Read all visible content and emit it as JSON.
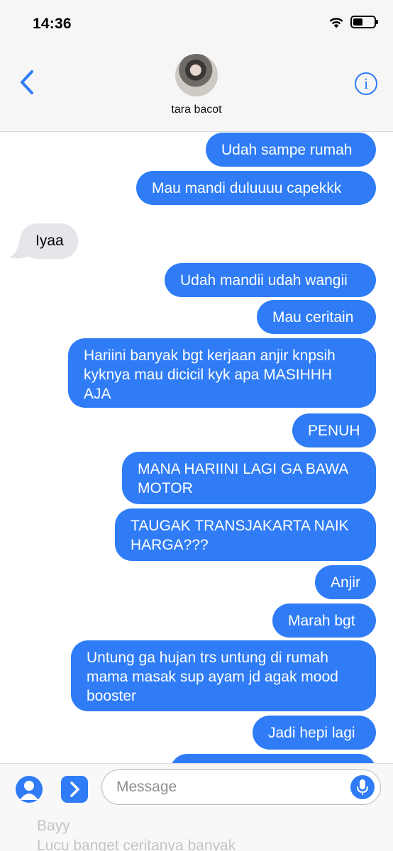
{
  "status_bar": {
    "time": "14:36",
    "battery_level": 0.45
  },
  "header": {
    "contact_name": "tara bacot",
    "info_glyph": "i",
    "back_icon": "chevron-left-icon",
    "info_icon": "info-circle-icon"
  },
  "messages": [
    {
      "from": "me",
      "text": "Udah sampe rumah"
    },
    {
      "from": "me",
      "text": "Mau mandi duluuuu capekkk"
    },
    {
      "from": "them",
      "text": "Iyaa"
    },
    {
      "from": "me",
      "text": "Udah mandii udah wangii"
    },
    {
      "from": "me",
      "text": "Mau ceritain"
    },
    {
      "from": "me",
      "text": "Hariini banyak bgt kerjaan anjir knpsih kyknya mau dicicil kyk apa MASIHHH AJA"
    },
    {
      "from": "me",
      "text": "PENUH"
    },
    {
      "from": "me",
      "text": "MANA HARIINI LAGI GA BAWA MOTOR"
    },
    {
      "from": "me",
      "text": "TAUGAK TRANSJAKARTA NAIK HARGA???"
    },
    {
      "from": "me",
      "text": "Anjir"
    },
    {
      "from": "me",
      "text": "Marah bgt"
    },
    {
      "from": "me",
      "text": "Untung ga hujan trs untung di rumah mama masak sup ayam jd agak mood booster"
    },
    {
      "from": "me",
      "text": "Jadi hepi lagi"
    }
  ],
  "input_bar": {
    "placeholder": "Message",
    "ghost_lines": [
      "Bayy",
      "Lucu banget ceritanya banyak"
    ]
  },
  "colors": {
    "accent": "#2f7cf6",
    "received_bubble": "#e6e5ea",
    "bar_background": "#f6f6f6"
  }
}
